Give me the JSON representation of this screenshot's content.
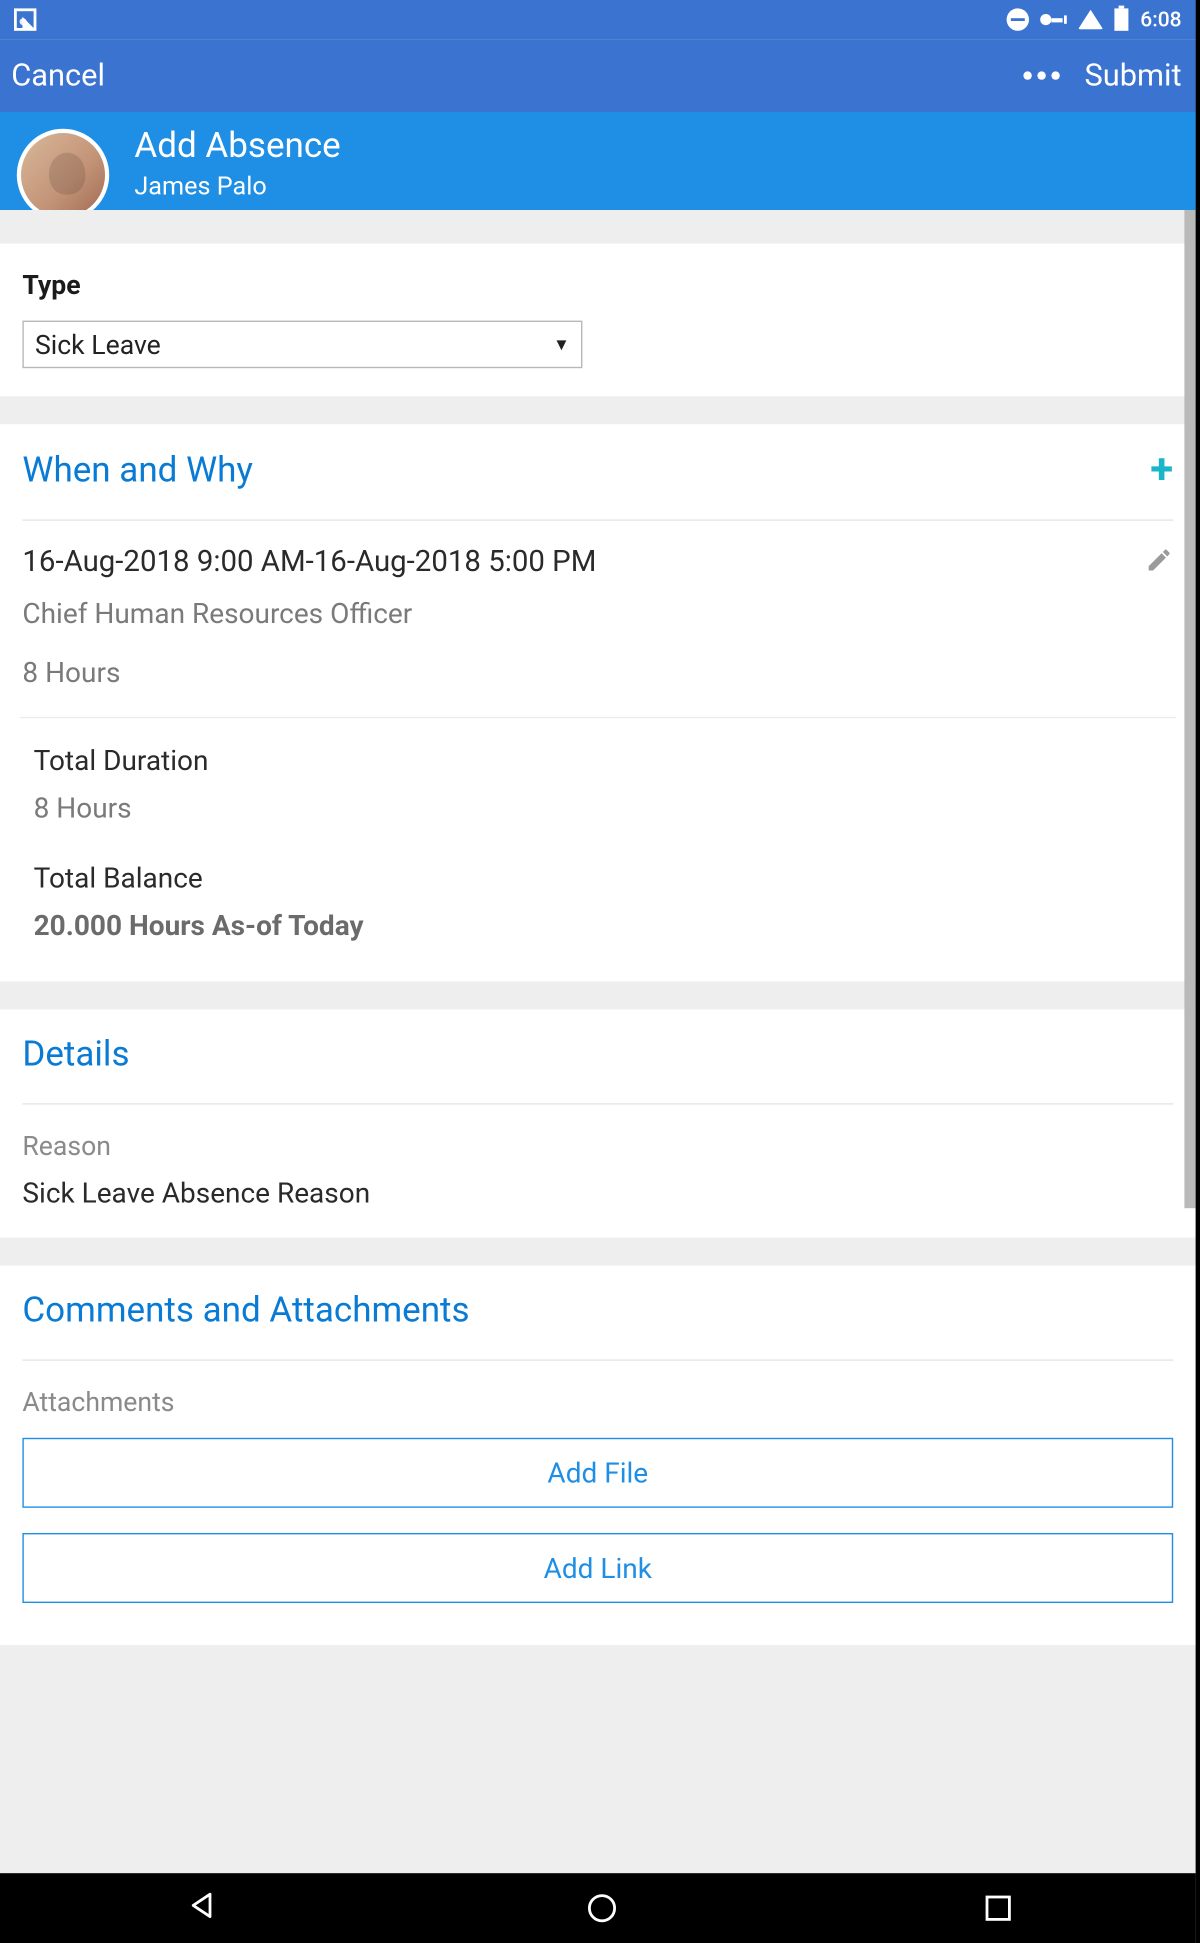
{
  "status": {
    "time": "6:08"
  },
  "appbar": {
    "cancel": "Cancel",
    "submit": "Submit"
  },
  "header": {
    "title": "Add Absence",
    "user": "James Palo"
  },
  "type": {
    "label": "Type",
    "value": "Sick Leave"
  },
  "when": {
    "title": "When and Why",
    "range": "16-Aug-2018 9:00 AM-16-Aug-2018 5:00 PM",
    "role": "Chief Human Resources Officer",
    "hours": "8 Hours",
    "total_duration_label": "Total Duration",
    "total_duration_value": "8 Hours",
    "total_balance_label": "Total Balance",
    "total_balance_value": "20.000 Hours As-of Today"
  },
  "details": {
    "title": "Details",
    "reason_label": "Reason",
    "reason_value": "Sick Leave Absence Reason"
  },
  "comments": {
    "title": "Comments and Attachments",
    "attachments_label": "Attachments",
    "add_file": "Add File",
    "add_link": "Add Link"
  }
}
